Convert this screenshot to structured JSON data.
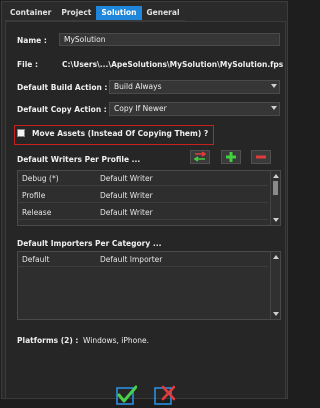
{
  "tabs": [
    {
      "label": "Container"
    },
    {
      "label": "Project"
    },
    {
      "label": "Solution"
    },
    {
      "label": "General"
    }
  ],
  "form": {
    "name_label": "Name :",
    "name_value": "MySolution",
    "file_label": "File :",
    "file_value": "C:\\Users\\...\\ApeSolutions\\MySolution\\MySolution.fps",
    "build_action_label": "Default Build Action :",
    "build_action_value": "Build Always",
    "copy_action_label": "Default Copy Action :",
    "copy_action_value": "Copy If Newer",
    "move_assets_label": "Move Assets (Instead Of Copying Them) ?",
    "move_assets_checked": false
  },
  "writers": {
    "header": "Default Writers Per Profile ...",
    "rows": [
      {
        "profile": "Debug (*)",
        "writer": "Default Writer"
      },
      {
        "profile": "Profile",
        "writer": "Default Writer"
      },
      {
        "profile": "Release",
        "writer": "Default Writer"
      }
    ]
  },
  "importers": {
    "header": "Default Importers Per Category ...",
    "rows": [
      {
        "category": "Default",
        "importer": "Default Importer"
      }
    ]
  },
  "platforms": {
    "label": "Platforms (2) :",
    "value": "Windows, iPhone."
  },
  "icons": {
    "swap": "swap-arrows-icon",
    "add": "plus-icon",
    "remove": "minus-icon",
    "ok": "checkmark-icon",
    "cancel": "cancel-x-icon"
  },
  "colors": {
    "accent": "#1f86d9",
    "highlight_border": "#c62020",
    "add": "#3fcf3f",
    "remove": "#e23b3b"
  }
}
